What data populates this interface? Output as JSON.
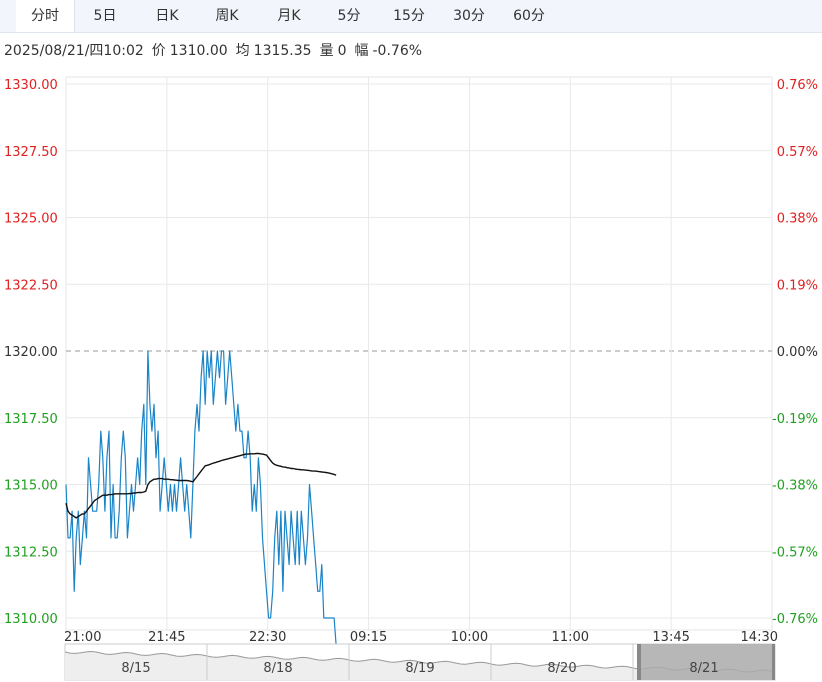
{
  "tabs": {
    "items": [
      "分时",
      "5日",
      "日K",
      "周K",
      "月K",
      "5分",
      "15分",
      "30分",
      "60分"
    ],
    "active_index": 0
  },
  "info": {
    "datetime": "2025/08/21/四10:02",
    "price_label": "价",
    "price": "1310.00",
    "avg_label": "均",
    "avg": "1315.35",
    "volume_label": "量",
    "volume": "0",
    "change_label": "幅",
    "change": "-0.76%"
  },
  "colors": {
    "up": "#e02020",
    "down": "#20a020",
    "price_line": "#1a84c8",
    "avg_line": "#111111",
    "grid": "#e9e9e9",
    "tab_bg": "#f2f6fc"
  },
  "chart_data": {
    "type": "line",
    "title": "",
    "ylim": [
      1310.0,
      1330.0
    ],
    "prev_close": 1320.0,
    "y_ticks": [
      "1330.00",
      "1327.50",
      "1325.00",
      "1322.50",
      "1320.00",
      "1317.50",
      "1315.00",
      "1312.50",
      "1310.00"
    ],
    "pct_ticks": [
      "0.76%",
      "0.57%",
      "0.38%",
      "0.19%",
      "0.00%",
      "-0.19%",
      "-0.38%",
      "-0.57%",
      "-0.76%"
    ],
    "x_ticks": [
      "21:00",
      "21:45",
      "22:30",
      "09:15",
      "10:00",
      "11:00",
      "13:45",
      "14:30"
    ],
    "grid": true,
    "total_minutes": 345,
    "series": [
      {
        "key": "price",
        "color": "#1a84c8",
        "values": [
          1315,
          1313,
          1313,
          1314,
          1311,
          1313,
          1314,
          1312,
          1313,
          1314,
          1313,
          1316,
          1315,
          1314,
          1314,
          1314,
          1315,
          1317,
          1316,
          1314,
          1316,
          1317,
          1313,
          1315,
          1313,
          1313,
          1314,
          1316,
          1317,
          1316,
          1313,
          1314,
          1315,
          1314,
          1315,
          1316,
          1315,
          1317,
          1318,
          1315,
          1320,
          1318,
          1317,
          1318,
          1316,
          1317,
          1314,
          1315,
          1316,
          1315,
          1314,
          1315,
          1314,
          1315,
          1314,
          1315,
          1316,
          1315,
          1314,
          1315,
          1314,
          1313,
          1315,
          1317,
          1318,
          1317,
          1319,
          1320,
          1318,
          1320,
          1319,
          1320,
          1318,
          1319,
          1320,
          1319,
          1320,
          1320,
          1318,
          1319,
          1320,
          1319,
          1318,
          1317,
          1318,
          1317,
          1317,
          1316,
          1316,
          1317,
          1316,
          1314,
          1315,
          1314,
          1316,
          1315,
          1313,
          1312,
          1311,
          1310,
          1310,
          1311,
          1313,
          1314,
          1312,
          1314,
          1311,
          1314,
          1313,
          1312,
          1314,
          1313,
          1312,
          1314,
          1312,
          1314,
          1313,
          1312,
          1313,
          1315,
          1314,
          1313,
          1312,
          1311,
          1311,
          1312,
          1310,
          1310,
          1310,
          1310,
          1310,
          1310,
          1309
        ],
        "x_start_minute": 0
      },
      {
        "key": "average",
        "color": "#111111",
        "values": [
          1314.3,
          1314.0,
          1313.9,
          1313.85,
          1313.8,
          1313.75,
          1313.8,
          1313.85,
          1313.9,
          1313.9,
          1314.0,
          1314.1,
          1314.2,
          1314.3,
          1314.4,
          1314.45,
          1314.5,
          1314.55,
          1314.6,
          1314.6,
          1314.6,
          1314.62,
          1314.62,
          1314.63,
          1314.65,
          1314.65,
          1314.65,
          1314.65,
          1314.65,
          1314.65,
          1314.65,
          1314.66,
          1314.66,
          1314.68,
          1314.68,
          1314.7,
          1314.7,
          1314.7,
          1314.72,
          1314.75,
          1315.0,
          1315.1,
          1315.15,
          1315.2,
          1315.2,
          1315.22,
          1315.22,
          1315.22,
          1315.2,
          1315.2,
          1315.2,
          1315.18,
          1315.18,
          1315.17,
          1315.16,
          1315.15,
          1315.15,
          1315.15,
          1315.15,
          1315.15,
          1315.14,
          1315.12,
          1315.1,
          1315.2,
          1315.3,
          1315.4,
          1315.5,
          1315.6,
          1315.7,
          1315.72,
          1315.74,
          1315.77,
          1315.8,
          1315.82,
          1315.85,
          1315.87,
          1315.9,
          1315.92,
          1315.94,
          1315.96,
          1315.98,
          1316.0,
          1316.02,
          1316.04,
          1316.06,
          1316.08,
          1316.1,
          1316.12,
          1316.14,
          1316.14,
          1316.15,
          1316.15,
          1316.15,
          1316.16,
          1316.16,
          1316.15,
          1316.14,
          1316.12,
          1316.1,
          1316.0,
          1315.9,
          1315.8,
          1315.75,
          1315.72,
          1315.7,
          1315.68,
          1315.66,
          1315.65,
          1315.63,
          1315.62,
          1315.6,
          1315.6,
          1315.58,
          1315.57,
          1315.56,
          1315.55,
          1315.55,
          1315.54,
          1315.53,
          1315.52,
          1315.51,
          1315.5,
          1315.5,
          1315.49,
          1315.48,
          1315.47,
          1315.46,
          1315.45,
          1315.44,
          1315.42,
          1315.4,
          1315.38,
          1315.35
        ],
        "x_start_minute": 0
      }
    ]
  },
  "navigator": {
    "dates": [
      "8/15",
      "8/18",
      "8/19",
      "8/20",
      "8/21"
    ],
    "selected_index": 4
  }
}
